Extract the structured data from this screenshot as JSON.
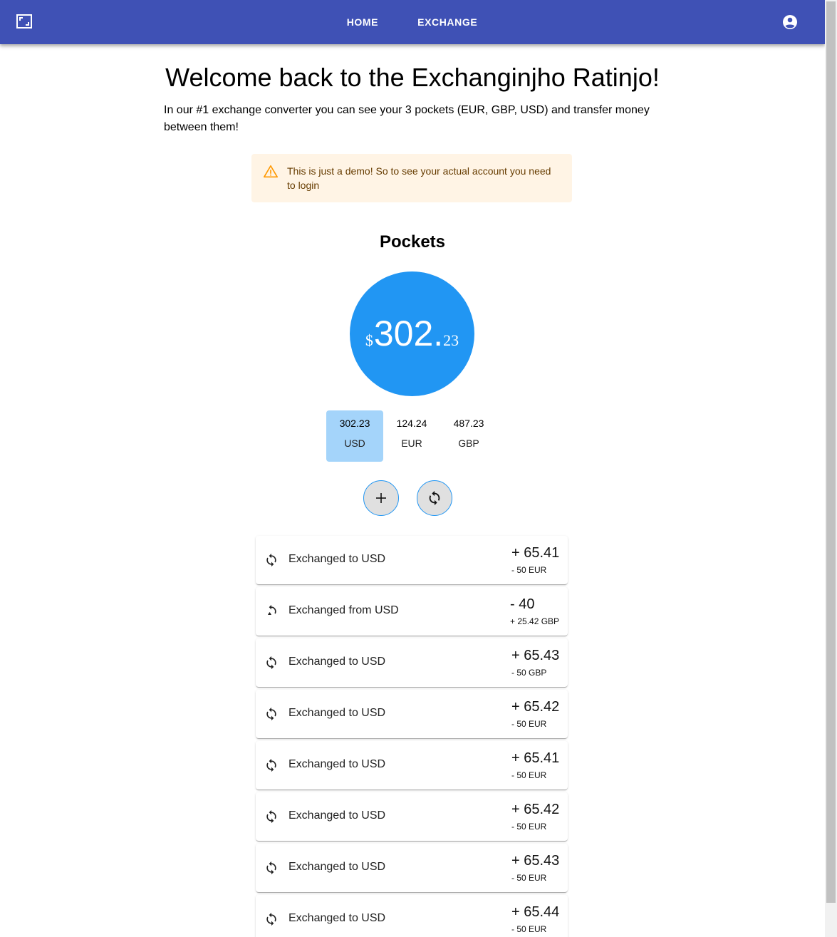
{
  "header": {
    "nav": [
      {
        "label": "HOME"
      },
      {
        "label": "EXCHANGE"
      }
    ]
  },
  "main": {
    "title": "Welcome back to the Exchanginjho Ratinjo!",
    "subtitle": "In our #1 exchange converter you can see your 3 pockets (EUR, GBP, USD) and transfer money between them!",
    "alert": "This is just a demo! So to see your actual account you need to login",
    "pockets_title": "Pockets",
    "balance": {
      "symbol": "$",
      "integer": "302.",
      "decimal": "23"
    },
    "pockets": [
      {
        "amount": "302.23",
        "code": "USD",
        "active": true
      },
      {
        "amount": "124.24",
        "code": "EUR",
        "active": false
      },
      {
        "amount": "487.23",
        "code": "GBP",
        "active": false
      }
    ],
    "actions": {
      "add_icon": "plus-icon",
      "exchange_icon": "exchange-icon"
    },
    "transactions": [
      {
        "label": "Exchanged to USD",
        "amount": "+ 65.41",
        "sub": "- 50 EUR"
      },
      {
        "label": "Exchanged from USD",
        "amount": "- 40",
        "sub": "+ 25.42 GBP"
      },
      {
        "label": "Exchanged to USD",
        "amount": "+ 65.43",
        "sub": "- 50 GBP"
      },
      {
        "label": "Exchanged to USD",
        "amount": "+ 65.42",
        "sub": "- 50 EUR"
      },
      {
        "label": "Exchanged to USD",
        "amount": "+ 65.41",
        "sub": "- 50 EUR"
      },
      {
        "label": "Exchanged to USD",
        "amount": "+ 65.42",
        "sub": "- 50 EUR"
      },
      {
        "label": "Exchanged to USD",
        "amount": "+ 65.43",
        "sub": "- 50 EUR"
      },
      {
        "label": "Exchanged to USD",
        "amount": "+ 65.44",
        "sub": "- 50 EUR"
      }
    ]
  },
  "colors": {
    "appbar": "#3f51b5",
    "primary": "#2196f3",
    "active_tab": "#a4d4fa",
    "alert_bg": "#fff4e5",
    "alert_text": "#663c00",
    "warning_icon": "#ff9800"
  }
}
